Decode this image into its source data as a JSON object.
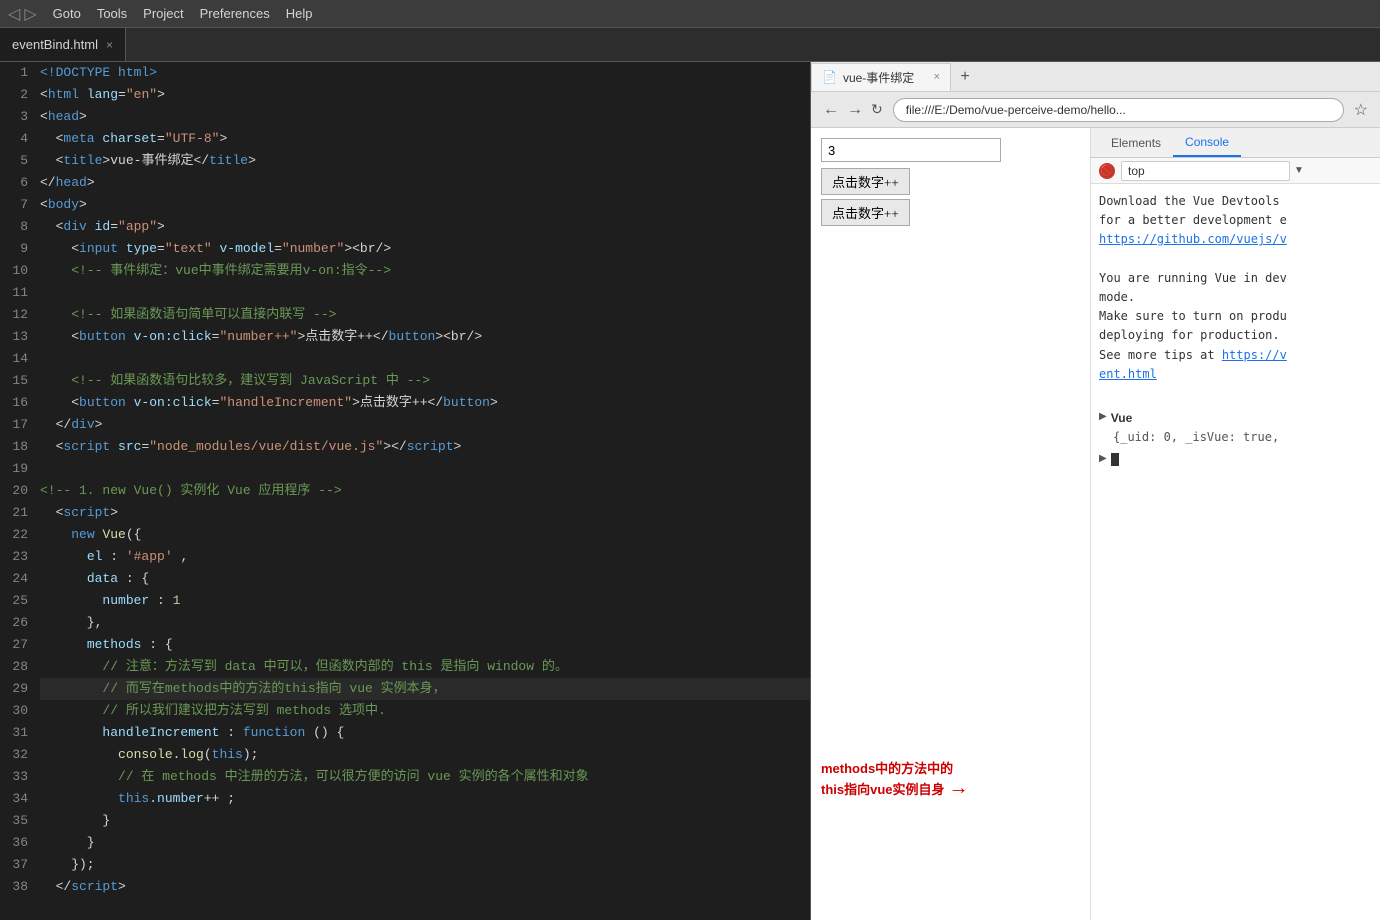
{
  "menuBar": {
    "items": [
      "Goto",
      "Tools",
      "Project",
      "Preferences",
      "Help"
    ]
  },
  "tab": {
    "filename": "eventBind.html",
    "close": "×"
  },
  "browserTab": {
    "title": "vue-事件绑定",
    "close": "×",
    "url": "file:///E:/Demo/vue-perceive-demo/hello..."
  },
  "devtools": {
    "tabs": [
      "Elements",
      "Console"
    ],
    "activeTab": "Console",
    "filterLabel": "top",
    "filterArrow": "▼"
  },
  "consoleMessages": [
    "Download the Vue Devtools",
    "for a better development e",
    "https://github.com/vuejs/v",
    "",
    "You are running Vue in dev",
    "mode.",
    "Make sure to turn on produ",
    "deploying for production.",
    "See more tips at https://v",
    "ent.html"
  ],
  "vueObject": {
    "triangle": "▶",
    "text": "Vue",
    "content": "{_uid: 0, _isVue: true,"
  },
  "annotation": {
    "line1": "methods中的方法中的",
    "line2": "this指向vue实例自身"
  },
  "inputValue": "3",
  "buttons": {
    "btn1": "点击数字++",
    "btn2": "点击数字++"
  },
  "codeLines": [
    {
      "num": 1,
      "html": "&lt;!DOCTYPE html&gt;",
      "tokens": [
        {
          "t": "doctype",
          "v": "<!DOCTYPE html>"
        }
      ]
    },
    {
      "num": 2,
      "tokens": [
        {
          "t": "punc",
          "v": "<"
        },
        {
          "t": "kw",
          "v": "html"
        },
        {
          "t": "attr",
          "v": " lang"
        },
        {
          "t": "punc",
          "v": "="
        },
        {
          "t": "str",
          "v": "\"en\""
        },
        {
          "t": "punc",
          "v": ">"
        }
      ]
    },
    {
      "num": 3,
      "tokens": [
        {
          "t": "punc",
          "v": "<"
        },
        {
          "t": "kw",
          "v": "head"
        },
        {
          "t": "punc",
          "v": ">"
        }
      ]
    },
    {
      "num": 4,
      "tokens": [
        {
          "t": "punc",
          "v": "  <"
        },
        {
          "t": "kw",
          "v": "meta"
        },
        {
          "t": "attr",
          "v": " charset"
        },
        {
          "t": "punc",
          "v": "="
        },
        {
          "t": "str",
          "v": "\"UTF-8\""
        },
        {
          "t": "punc",
          "v": ">"
        }
      ]
    },
    {
      "num": 5,
      "tokens": [
        {
          "t": "punc",
          "v": "  <"
        },
        {
          "t": "kw",
          "v": "title"
        },
        {
          "t": "punc",
          "v": ">"
        },
        {
          "t": "plain",
          "v": "vue-事件绑定"
        },
        {
          "t": "punc",
          "v": "</"
        },
        {
          "t": "kw",
          "v": "title"
        },
        {
          "t": "punc",
          "v": ">"
        }
      ]
    },
    {
      "num": 6,
      "tokens": [
        {
          "t": "punc",
          "v": "</"
        },
        {
          "t": "kw",
          "v": "head"
        },
        {
          "t": "punc",
          "v": ">"
        }
      ]
    },
    {
      "num": 7,
      "tokens": [
        {
          "t": "punc",
          "v": "<"
        },
        {
          "t": "kw",
          "v": "body"
        },
        {
          "t": "punc",
          "v": ">"
        }
      ]
    },
    {
      "num": 8,
      "tokens": [
        {
          "t": "punc",
          "v": "  <"
        },
        {
          "t": "kw",
          "v": "div"
        },
        {
          "t": "attr",
          "v": " id"
        },
        {
          "t": "punc",
          "v": "="
        },
        {
          "t": "str",
          "v": "\"app\""
        },
        {
          "t": "punc",
          "v": ">"
        }
      ]
    },
    {
      "num": 9,
      "tokens": [
        {
          "t": "punc",
          "v": "    <"
        },
        {
          "t": "kw",
          "v": "input"
        },
        {
          "t": "attr",
          "v": " type"
        },
        {
          "t": "punc",
          "v": "="
        },
        {
          "t": "str",
          "v": "\"text\""
        },
        {
          "t": "attr",
          "v": " v-model"
        },
        {
          "t": "punc",
          "v": "="
        },
        {
          "t": "str",
          "v": "\"number\""
        },
        {
          "t": "punc",
          "v": "><br/>"
        }
      ]
    },
    {
      "num": 10,
      "tokens": [
        {
          "t": "comment",
          "v": "    <!-- 事件绑定：vue中事件绑定需要用v-on:指令-->"
        }
      ]
    },
    {
      "num": 11,
      "tokens": []
    },
    {
      "num": 12,
      "tokens": [
        {
          "t": "comment",
          "v": "    <!-- 如果函数语句简单可以直接内联写 -->"
        }
      ]
    },
    {
      "num": 13,
      "tokens": [
        {
          "t": "punc",
          "v": "    <"
        },
        {
          "t": "kw",
          "v": "button"
        },
        {
          "t": "attr",
          "v": " v-on:click"
        },
        {
          "t": "punc",
          "v": "="
        },
        {
          "t": "str",
          "v": "\"number++\""
        },
        {
          "t": "punc",
          "v": ">"
        },
        {
          "t": "plain",
          "v": "点击数字++"
        },
        {
          "t": "punc",
          "v": "</"
        },
        {
          "t": "kw",
          "v": "button"
        },
        {
          "t": "punc",
          "v": "><br/>"
        }
      ]
    },
    {
      "num": 14,
      "tokens": []
    },
    {
      "num": 15,
      "tokens": [
        {
          "t": "comment",
          "v": "    <!-- 如果函数语句比较多，建议写到 JavaScript 中 -->"
        }
      ]
    },
    {
      "num": 16,
      "tokens": [
        {
          "t": "punc",
          "v": "    <"
        },
        {
          "t": "kw",
          "v": "button"
        },
        {
          "t": "attr",
          "v": " v-on:click"
        },
        {
          "t": "punc",
          "v": "="
        },
        {
          "t": "str",
          "v": "\"handleIncrement\""
        },
        {
          "t": "punc",
          "v": ">"
        },
        {
          "t": "plain",
          "v": "点击数字++"
        },
        {
          "t": "punc",
          "v": "</"
        },
        {
          "t": "kw",
          "v": "button"
        },
        {
          "t": "punc",
          "v": ">"
        }
      ]
    },
    {
      "num": 17,
      "tokens": [
        {
          "t": "punc",
          "v": "  </"
        },
        {
          "t": "kw",
          "v": "div"
        },
        {
          "t": "punc",
          "v": ">"
        }
      ]
    },
    {
      "num": 18,
      "tokens": [
        {
          "t": "punc",
          "v": "  <"
        },
        {
          "t": "kw",
          "v": "script"
        },
        {
          "t": "attr",
          "v": " src"
        },
        {
          "t": "punc",
          "v": "="
        },
        {
          "t": "str",
          "v": "\"node_modules/vue/dist/vue.js\""
        },
        {
          "t": "punc",
          "v": "></"
        },
        {
          "t": "kw",
          "v": "script"
        },
        {
          "t": "punc",
          "v": ">"
        }
      ]
    },
    {
      "num": 19,
      "tokens": []
    },
    {
      "num": 20,
      "tokens": [
        {
          "t": "comment",
          "v": "<!-- 1. new Vue() 实例化 Vue 应用程序 -->"
        }
      ]
    },
    {
      "num": 21,
      "tokens": [
        {
          "t": "punc",
          "v": "  <"
        },
        {
          "t": "kw",
          "v": "script"
        },
        {
          "t": "punc",
          "v": ">"
        }
      ]
    },
    {
      "num": 22,
      "tokens": [
        {
          "t": "punc",
          "v": "    "
        },
        {
          "t": "kw",
          "v": "new"
        },
        {
          "t": "punc",
          "v": " "
        },
        {
          "t": "fn",
          "v": "Vue"
        },
        {
          "t": "punc",
          "v": "({"
        }
      ]
    },
    {
      "num": 23,
      "tokens": [
        {
          "t": "punc",
          "v": "      "
        },
        {
          "t": "prop",
          "v": "el"
        },
        {
          "t": "punc",
          "v": " : "
        },
        {
          "t": "str",
          "v": "'#app'"
        },
        {
          "t": "punc",
          "v": " ,"
        }
      ]
    },
    {
      "num": 24,
      "tokens": [
        {
          "t": "punc",
          "v": "      "
        },
        {
          "t": "prop",
          "v": "data"
        },
        {
          "t": "punc",
          "v": " : {"
        }
      ]
    },
    {
      "num": 25,
      "tokens": [
        {
          "t": "punc",
          "v": "        "
        },
        {
          "t": "prop",
          "v": "number"
        },
        {
          "t": "punc",
          "v": " : "
        },
        {
          "t": "num",
          "v": "1"
        }
      ]
    },
    {
      "num": 26,
      "tokens": [
        {
          "t": "punc",
          "v": "      },"
        }
      ]
    },
    {
      "num": 27,
      "tokens": [
        {
          "t": "punc",
          "v": "      "
        },
        {
          "t": "prop",
          "v": "methods"
        },
        {
          "t": "punc",
          "v": " : {"
        }
      ]
    },
    {
      "num": 28,
      "tokens": [
        {
          "t": "comment",
          "v": "        // 注意：方法写到 data 中可以，但函数内部的 this 是指向 window 的。"
        }
      ]
    },
    {
      "num": 29,
      "tokens": [
        {
          "t": "comment",
          "v": "        // 而写在methods中的方法的this指向 vue 实例本身，"
        }
      ],
      "highlight": true
    },
    {
      "num": 30,
      "tokens": [
        {
          "t": "comment",
          "v": "        // 所以我们建议把方法写到 methods 选项中."
        }
      ]
    },
    {
      "num": 31,
      "tokens": [
        {
          "t": "punc",
          "v": "        "
        },
        {
          "t": "prop",
          "v": "handleIncrement"
        },
        {
          "t": "punc",
          "v": " : "
        },
        {
          "t": "kw",
          "v": "function"
        },
        {
          "t": "punc",
          "v": " () {"
        }
      ]
    },
    {
      "num": 32,
      "tokens": [
        {
          "t": "punc",
          "v": "          "
        },
        {
          "t": "fn",
          "v": "console.log"
        },
        {
          "t": "punc",
          "v": "("
        },
        {
          "t": "kw",
          "v": "this"
        },
        {
          "t": "punc",
          "v": ");"
        }
      ]
    },
    {
      "num": 33,
      "tokens": [
        {
          "t": "comment",
          "v": "          // 在 methods 中注册的方法，可以很方便的访问 vue 实例的各个属性和对象"
        }
      ]
    },
    {
      "num": 34,
      "tokens": [
        {
          "t": "punc",
          "v": "          "
        },
        {
          "t": "kw",
          "v": "this"
        },
        {
          "t": "punc",
          "v": "."
        },
        {
          "t": "prop",
          "v": "number"
        },
        {
          "t": "punc",
          "v": "++ ;"
        }
      ]
    },
    {
      "num": 35,
      "tokens": [
        {
          "t": "punc",
          "v": "        }"
        }
      ]
    },
    {
      "num": 36,
      "tokens": [
        {
          "t": "punc",
          "v": "      }"
        }
      ]
    },
    {
      "num": 37,
      "tokens": [
        {
          "t": "punc",
          "v": "    });"
        }
      ]
    },
    {
      "num": 38,
      "tokens": [
        {
          "t": "punc",
          "v": "  </"
        },
        {
          "t": "kw",
          "v": "script"
        },
        {
          "t": "punc",
          "v": ">"
        }
      ]
    }
  ]
}
